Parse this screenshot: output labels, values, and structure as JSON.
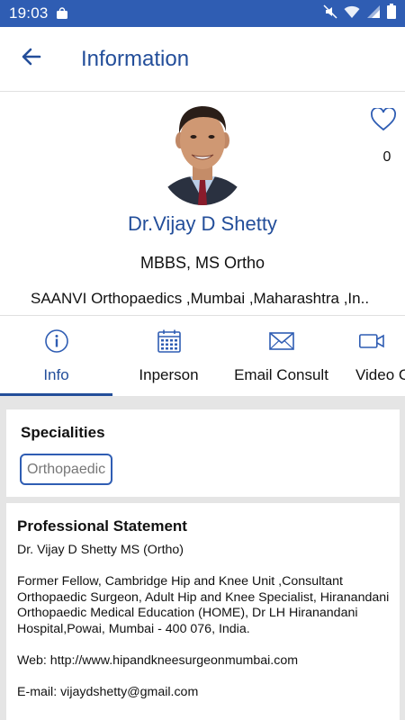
{
  "status_bar": {
    "time": "19:03",
    "bag_icon": "shopping-bag-icon",
    "icons": [
      "mute-icon",
      "wifi-icon",
      "signal-icon",
      "battery-icon"
    ]
  },
  "app_bar": {
    "back_icon": "arrow-left-icon",
    "title": "Information"
  },
  "profile": {
    "name": "Dr.Vijay D Shetty",
    "degree": "MBBS, MS Ortho",
    "clinic": "SAANVI Orthopaedics ,Mumbai ,Maharashtra ,In..",
    "favorite_icon": "heart-outline-icon",
    "favorite_count": "0"
  },
  "tabs": [
    {
      "label": "Info",
      "icon": "info-circle-icon",
      "active": true
    },
    {
      "label": "Inperson",
      "icon": "calendar-icon",
      "active": false
    },
    {
      "label": "Email Consult",
      "icon": "envelope-icon",
      "active": false
    },
    {
      "label": "Video C",
      "icon": "video-camera-icon",
      "active": false
    }
  ],
  "specialities": {
    "heading": "Specialities",
    "items": [
      "Orthopaedic"
    ]
  },
  "professional_statement": {
    "heading": "Professional Statement",
    "paragraphs": [
      "Dr. Vijay D Shetty MS (Ortho)",
      "Former Fellow, Cambridge Hip and Knee Unit ,Consultant Orthopaedic Surgeon, Adult Hip and Knee Specialist, Hiranandani Orthopaedic Medical Education (HOME), Dr LH Hiranandani Hospital,Powai, Mumbai - 400 076, India.",
      "Web: http://www.hipandkneesurgeonmumbai.com",
      "E-mail: vijaydshetty@gmail.com"
    ]
  },
  "colors": {
    "status_bar": "#2f5db3",
    "primary": "#234e9a",
    "background": "#e5e5e5"
  }
}
